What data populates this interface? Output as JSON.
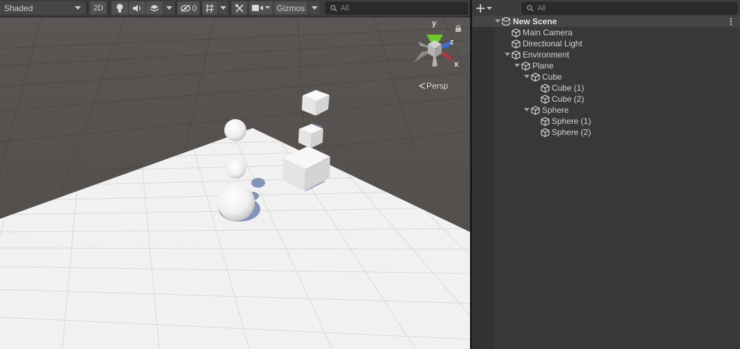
{
  "scene_view": {
    "toolbar": {
      "shading_mode": "Shaded",
      "mode_2d": "2D",
      "hidden_count": "0",
      "gizmos_label": "Gizmos",
      "search_placeholder": "All"
    },
    "axis_gizmo": {
      "y": "y",
      "z": "z",
      "x": "x"
    },
    "projection_label": "Persp"
  },
  "hierarchy": {
    "search_placeholder": "All",
    "items": [
      {
        "label": "New Scene"
      },
      {
        "label": "Main Camera"
      },
      {
        "label": "Directional Light"
      },
      {
        "label": "Environment"
      },
      {
        "label": "Plane"
      },
      {
        "label": "Cube"
      },
      {
        "label": "Cube (1)"
      },
      {
        "label": "Cube (2)"
      },
      {
        "label": "Sphere"
      },
      {
        "label": "Sphere (1)"
      },
      {
        "label": "Sphere (2)"
      }
    ]
  },
  "colors": {
    "axis_y": "#6ec82a",
    "axis_z": "#3a6ee8",
    "axis_x": "#d02d2d",
    "panel_bg": "#383838",
    "scene_bg": "#545454"
  }
}
